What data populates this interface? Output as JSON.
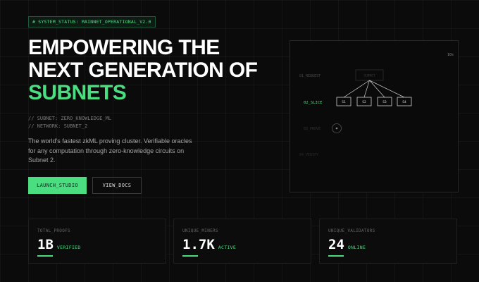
{
  "status_badge": "# SYSTEM_STATUS: MAINNET_OPERATIONAL_V2.0",
  "headline": {
    "line1": "EMPOWERING THE",
    "line2": "NEXT GENERATION OF",
    "line3": "SUBNETS"
  },
  "meta": {
    "subnet": "// SUBNET: ZERO_KNOWLEDGE_ML",
    "network": "// NETWORK: SUBNET_2"
  },
  "description": "The world's fastest zkML proving cluster. Verifiable oracles for any computation through zero-knowledge circuits on Subnet 2.",
  "buttons": {
    "launch": "LAUNCH_STUDIO",
    "docs": "VIEW_DOCS"
  },
  "visualization": {
    "corner_label": "10s",
    "rows": {
      "request": "01_REQUEST",
      "slice": "02_SLICE",
      "prove": "03_PROVE",
      "verify": "04_VERIFY"
    },
    "root_label": "SUBNET",
    "slices": [
      "S1",
      "S2",
      "S3",
      "S4"
    ],
    "accent": "#4ade80"
  },
  "stats": [
    {
      "label": "TOTAL_PROOFS",
      "value": "1B",
      "unit": "VERIFIED"
    },
    {
      "label": "UNIQUE_MINERS",
      "value": "1.7K",
      "unit": "ACTIVE"
    },
    {
      "label": "UNIQUE_VALIDATORS",
      "value": "24",
      "unit": "ONLINE"
    }
  ]
}
